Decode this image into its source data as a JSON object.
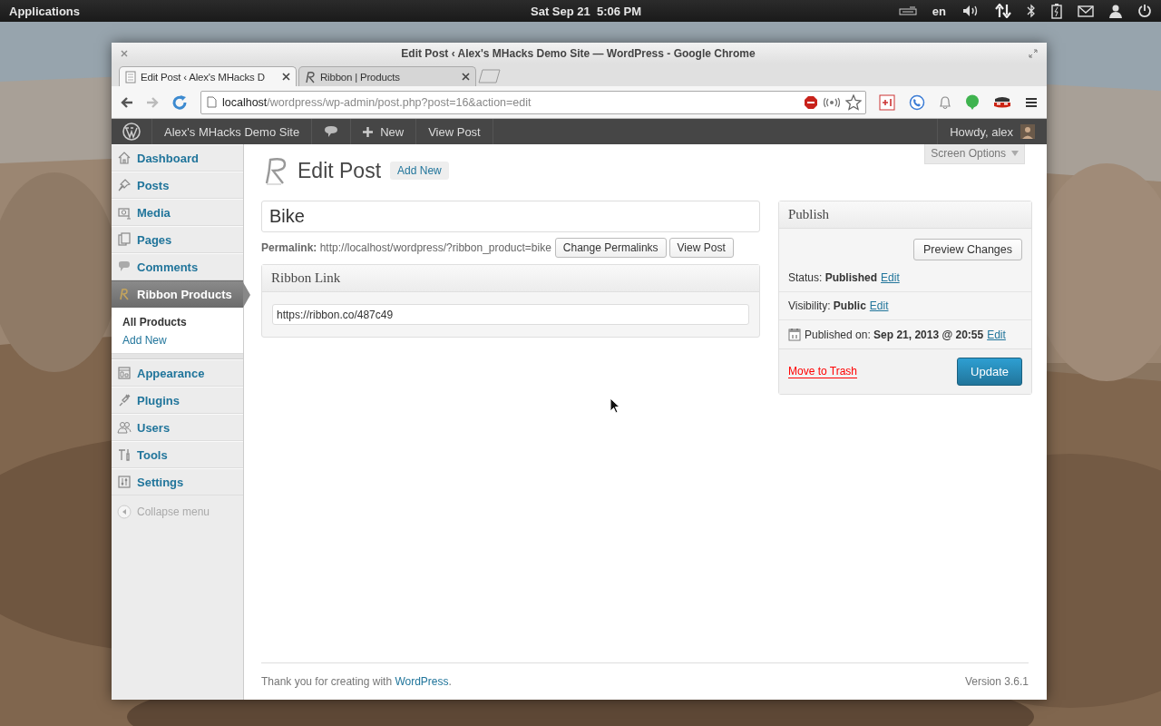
{
  "desktop_panel": {
    "menu": "Applications",
    "clock": "Sat Sep 21  5:06 PM",
    "keyboard_layout": "en"
  },
  "window": {
    "title": "Edit Post ‹ Alex's MHacks Demo Site — WordPress - Google Chrome"
  },
  "tabs": [
    {
      "label": "Edit Post ‹ Alex's MHacks D",
      "selected": true
    },
    {
      "label": "Ribbon | Products",
      "selected": false
    }
  ],
  "address_bar": {
    "host": "localhost",
    "path": "/wordpress/wp-admin/post.php?post=16&action=edit"
  },
  "admin_bar": {
    "site": "Alex's MHacks Demo Site",
    "new": "New",
    "view": "View Post",
    "greeting": "Howdy, alex"
  },
  "sidebar": {
    "items": [
      {
        "label": "Dashboard",
        "selected": false
      },
      {
        "label": "Posts",
        "selected": false
      },
      {
        "label": "Media",
        "selected": false
      },
      {
        "label": "Pages",
        "selected": false
      },
      {
        "label": "Comments",
        "selected": false
      },
      {
        "label": "Ribbon Products",
        "selected": true,
        "children": [
          {
            "label": "All Products",
            "selected": true
          },
          {
            "label": "Add New",
            "selected": false
          }
        ]
      },
      {
        "label": "Appearance",
        "selected": false
      },
      {
        "label": "Plugins",
        "selected": false
      },
      {
        "label": "Users",
        "selected": false
      },
      {
        "label": "Tools",
        "selected": false
      },
      {
        "label": "Settings",
        "selected": false
      }
    ],
    "collapse": "Collapse menu"
  },
  "screen_options": "Screen Options",
  "heading": {
    "title": "Edit Post",
    "add_new": "Add New"
  },
  "post_title": "Bike",
  "permalink": {
    "label": "Permalink:",
    "url": "http://localhost/wordpress/?ribbon_product=bike",
    "buttons": [
      "Change Permalinks",
      "View Post"
    ]
  },
  "ribbon_link": {
    "title": "Ribbon Link",
    "value": "https://ribbon.co/487c49"
  },
  "publish": {
    "title": "Publish",
    "preview": "Preview Changes",
    "rows": [
      {
        "label": "Status:",
        "value": "Published",
        "link": "Edit"
      },
      {
        "label": "Visibility:",
        "value": "Public",
        "link": "Edit"
      },
      {
        "label": "Published on:",
        "value": "Sep 21, 2013 @ 20:55",
        "link": "Edit"
      }
    ],
    "trash": "Move to Trash",
    "update": "Update"
  },
  "footer": {
    "text": "Thank you for creating with ",
    "link": "WordPress",
    "after": ".",
    "version": "Version 3.6.1"
  }
}
